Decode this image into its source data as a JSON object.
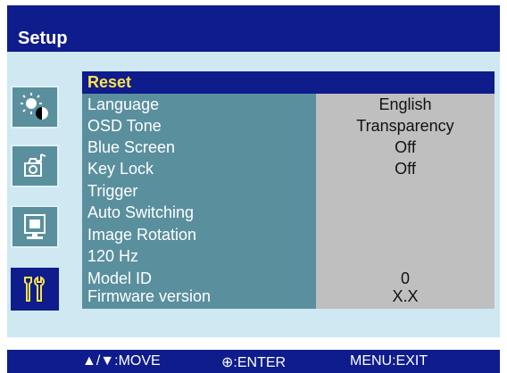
{
  "window": {
    "title": "Setup"
  },
  "sidebar": {
    "tabs": [
      {
        "name": "picture",
        "icon": "brightness-contrast-icon"
      },
      {
        "name": "audio",
        "icon": "audio-icon"
      },
      {
        "name": "display",
        "icon": "display-icon"
      },
      {
        "name": "setup",
        "icon": "tools-icon",
        "active": true
      }
    ]
  },
  "menu": {
    "items": [
      {
        "label": "Reset",
        "value": ""
      },
      {
        "label": "Language",
        "value": "English"
      },
      {
        "label": "OSD Tone",
        "value": "Transparency"
      },
      {
        "label": "Blue Screen",
        "value": "Off"
      },
      {
        "label": "Key Lock",
        "value": "Off"
      },
      {
        "label": "Trigger",
        "value": ""
      },
      {
        "label": "Auto Switching",
        "value": ""
      },
      {
        "label": "Image Rotation",
        "value": ""
      },
      {
        "label": "120 Hz",
        "value": ""
      },
      {
        "label": "Model ID",
        "value": "0"
      },
      {
        "label": "Firmware version",
        "value": "X.X"
      }
    ]
  },
  "footer": {
    "move_label": "▲/▼:MOVE",
    "enter_label": "⊕:ENTER",
    "exit_label": "MENU:EXIT"
  },
  "colors": {
    "title_bg": "#0e1c8c",
    "panel_bg": "#cfe8f2",
    "label_col": "#5a8f9e",
    "value_col": "#bfbfbf",
    "highlight_text": "#ffe34a"
  }
}
